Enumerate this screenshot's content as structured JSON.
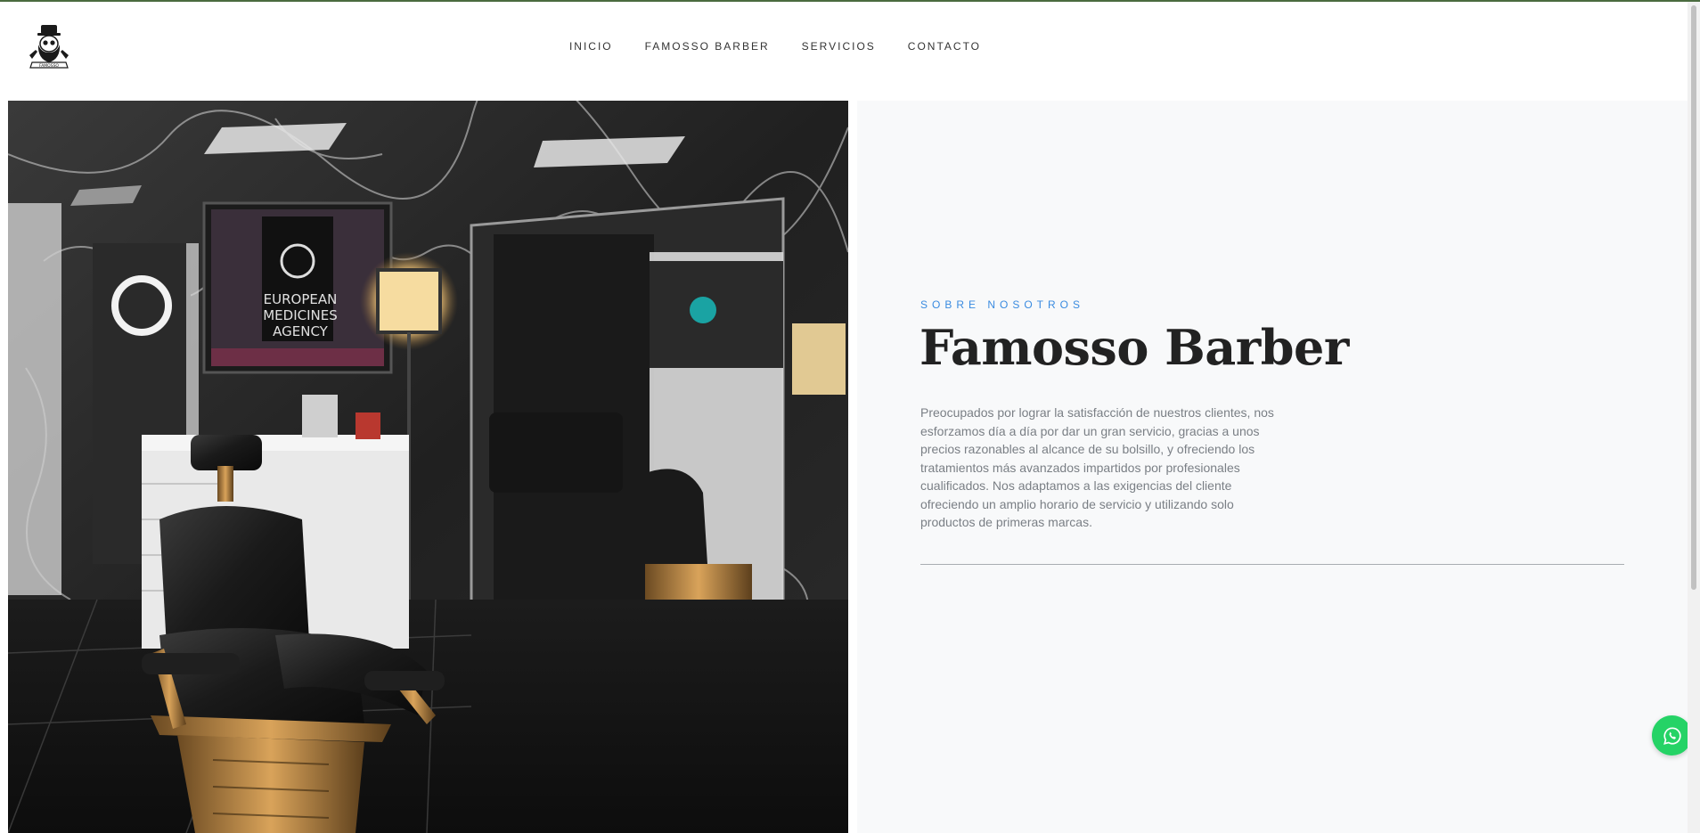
{
  "brand": {
    "logo_icon": "barber-skull-logo-icon",
    "logo_text": "FAMOSSO",
    "top_border_color": "#4a6b3f"
  },
  "nav": {
    "items": [
      {
        "label": "INICIO"
      },
      {
        "label": "FAMOSSO BARBER"
      },
      {
        "label": "SERVICIOS"
      },
      {
        "label": "CONTACTO"
      }
    ]
  },
  "hero_photo": {
    "tv_text_line1": "EUROPEAN",
    "tv_text_line2": "MEDICINES",
    "tv_text_line3": "AGENCY"
  },
  "about": {
    "eyebrow": "SOBRE NOSOTROS",
    "title": "Famosso Barber",
    "text": "Preocupados por lograr la satisfacción de nuestros clientes, nos esforzamos día a día por dar un gran servicio, gracias a unos precios razonables al alcance de su bolsillo, y ofreciendo los tratamientos más avanzados impartidos por profesionales cualificados. Nos adaptamos a las exigencias del cliente ofreciendo un amplio horario de servicio y utilizando solo productos de primeras marcas.",
    "eyebrow_color": "#3a8be0"
  },
  "whatsapp": {
    "icon": "whatsapp-icon",
    "color": "#25d366"
  }
}
